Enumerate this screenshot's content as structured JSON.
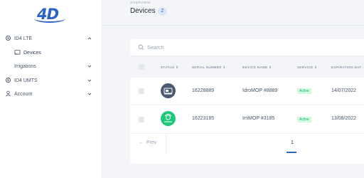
{
  "brand": {
    "logo_text": "4D"
  },
  "sidebar": {
    "items": [
      {
        "label": "ID4 LTE",
        "icon": "gear-icon",
        "expanded": true
      },
      {
        "label": "Devices",
        "icon": "cast-icon",
        "active": true
      },
      {
        "label": "Irrigations",
        "expanded": false
      },
      {
        "label": "ID4 UMTS",
        "icon": "gear-icon",
        "expanded": false
      },
      {
        "label": "Account",
        "icon": "user-icon",
        "expanded": false
      }
    ]
  },
  "header": {
    "overview": "OVERVIEW",
    "title": "Devices",
    "count": "2"
  },
  "search": {
    "placeholder": "Search"
  },
  "table": {
    "columns": [
      "STATUS",
      "SERIAL NUMBER",
      "DEVICE NAME",
      "SERVICE",
      "EXPIRATION DAT"
    ],
    "rows": [
      {
        "status_icon": "device-offline-icon",
        "status_color": "#4a5a73",
        "serial": "16228889",
        "name": "IdroMOP #8889",
        "service": "Active",
        "expiration": "14/07/2022"
      },
      {
        "status_icon": "device-online-icon",
        "status_color": "#1ec97a",
        "serial": "16223185",
        "name": "IrriMOP #3185",
        "service": "Active",
        "expiration": "13/08/2022"
      }
    ]
  },
  "pagination": {
    "prev_label": "Prev",
    "current_page": "1"
  },
  "colors": {
    "accent": "#2b63c9",
    "active_tag_bg": "#d1fadf",
    "active_tag_text": "#12b76a"
  }
}
